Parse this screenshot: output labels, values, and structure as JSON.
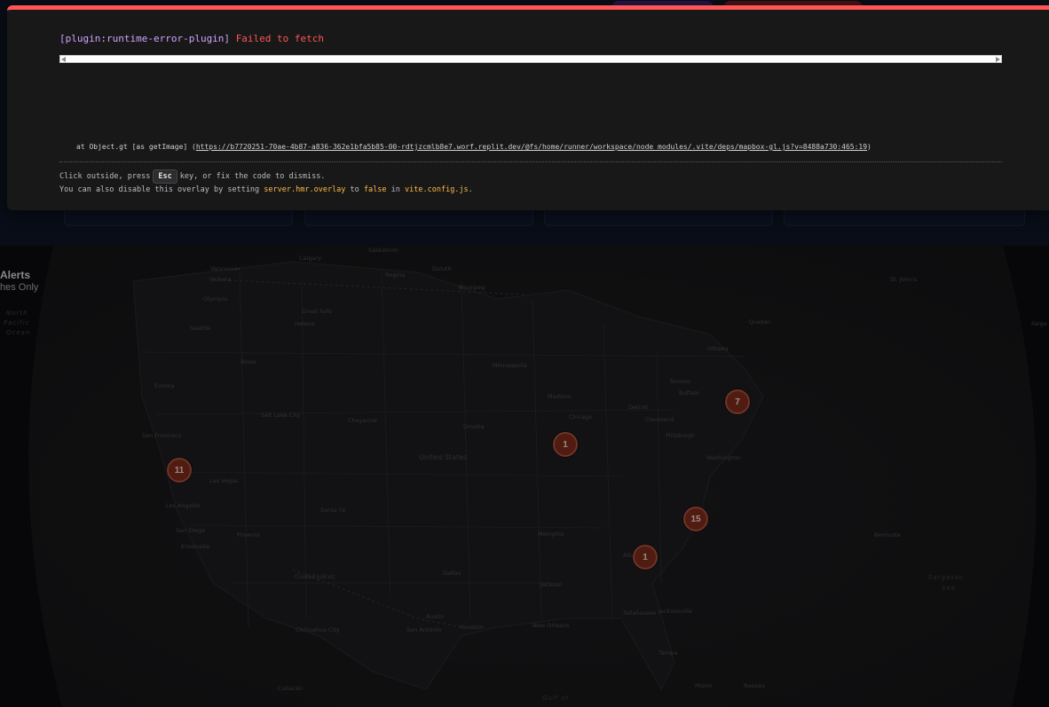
{
  "overlay": {
    "plugin": "[plugin:runtime-error-plugin]",
    "message": "Failed to fetch",
    "stack_prefix": "at Object.gt [as getImage] (",
    "stack_url": "https://b7720251-70ae-4b87-a836-362e1bfa5b85-00-rdtjzcmlb8e7.worf.replit.dev/@fs/home/runner/workspace/node_modules/.vite/deps/mapbox-gl.js?v=8488a730:465:19",
    "stack_suffix": ")",
    "tip_line1_a": "Click outside, press",
    "tip_key": "Esc",
    "tip_line1_b": "key, or fix the code to dismiss.",
    "tip_line2_a": "You can also disable this overlay by setting",
    "tip_line2_setting": "server.hmr.overlay",
    "tip_line2_b": "to",
    "tip_line2_value": "false",
    "tip_line2_c": "in",
    "tip_line2_file": "vite.config.js",
    "tip_line2_d": "."
  },
  "colors": {
    "error_border": "#ff5555",
    "plugin_text": "#cfa3ff",
    "highlight": "#ffbb44",
    "cluster_fill": "#7b2b1c",
    "cluster_border": "#a8513d"
  },
  "alerts_panel": {
    "title": "Alerts",
    "subtitle": "hes Only"
  },
  "clusters": [
    {
      "count": "11"
    },
    {
      "count": "1"
    },
    {
      "count": "7"
    },
    {
      "count": "15"
    },
    {
      "count": "1"
    }
  ],
  "map_labels": {
    "north_pacific": "North",
    "north_pacific_2": "Pacific",
    "north_pacific_3": "Ocean",
    "sargasso": "Sargasso",
    "sargasso_2": "Sea",
    "gulf": "Gulf of",
    "united_states": "United States",
    "cities": [
      "Calgary",
      "Saskatoon",
      "Regina",
      "Winnipeg",
      "Vancouver",
      "Victoria",
      "Olympia",
      "Seattle",
      "Great Falls",
      "Helena",
      "Boise",
      "Eureka",
      "Salt Lake City",
      "Cheyenne",
      "San Francisco",
      "Las Vegas",
      "Los Angeles",
      "San Diego",
      "Ensenada",
      "Phoenix",
      "Santa Fe",
      "Ciudad Juárez",
      "Chihuahua City",
      "Culiacán",
      "Omaha",
      "Dallas",
      "Austin",
      "San Antonio",
      "Houston",
      "New Orleans",
      "Memphis",
      "Jackson",
      "Minneapolis",
      "Madison",
      "Chicago",
      "Detroit",
      "Cleveland",
      "Pittsburgh",
      "Toronto",
      "Buffalo",
      "Ottawa",
      "Quebec",
      "Washington",
      "Atlanta",
      "Tallahassee",
      "Jacksonville",
      "Tampa",
      "Miami",
      "Nassau",
      "Bermuda",
      "St. John's",
      "Duluth",
      "Fargo"
    ]
  }
}
